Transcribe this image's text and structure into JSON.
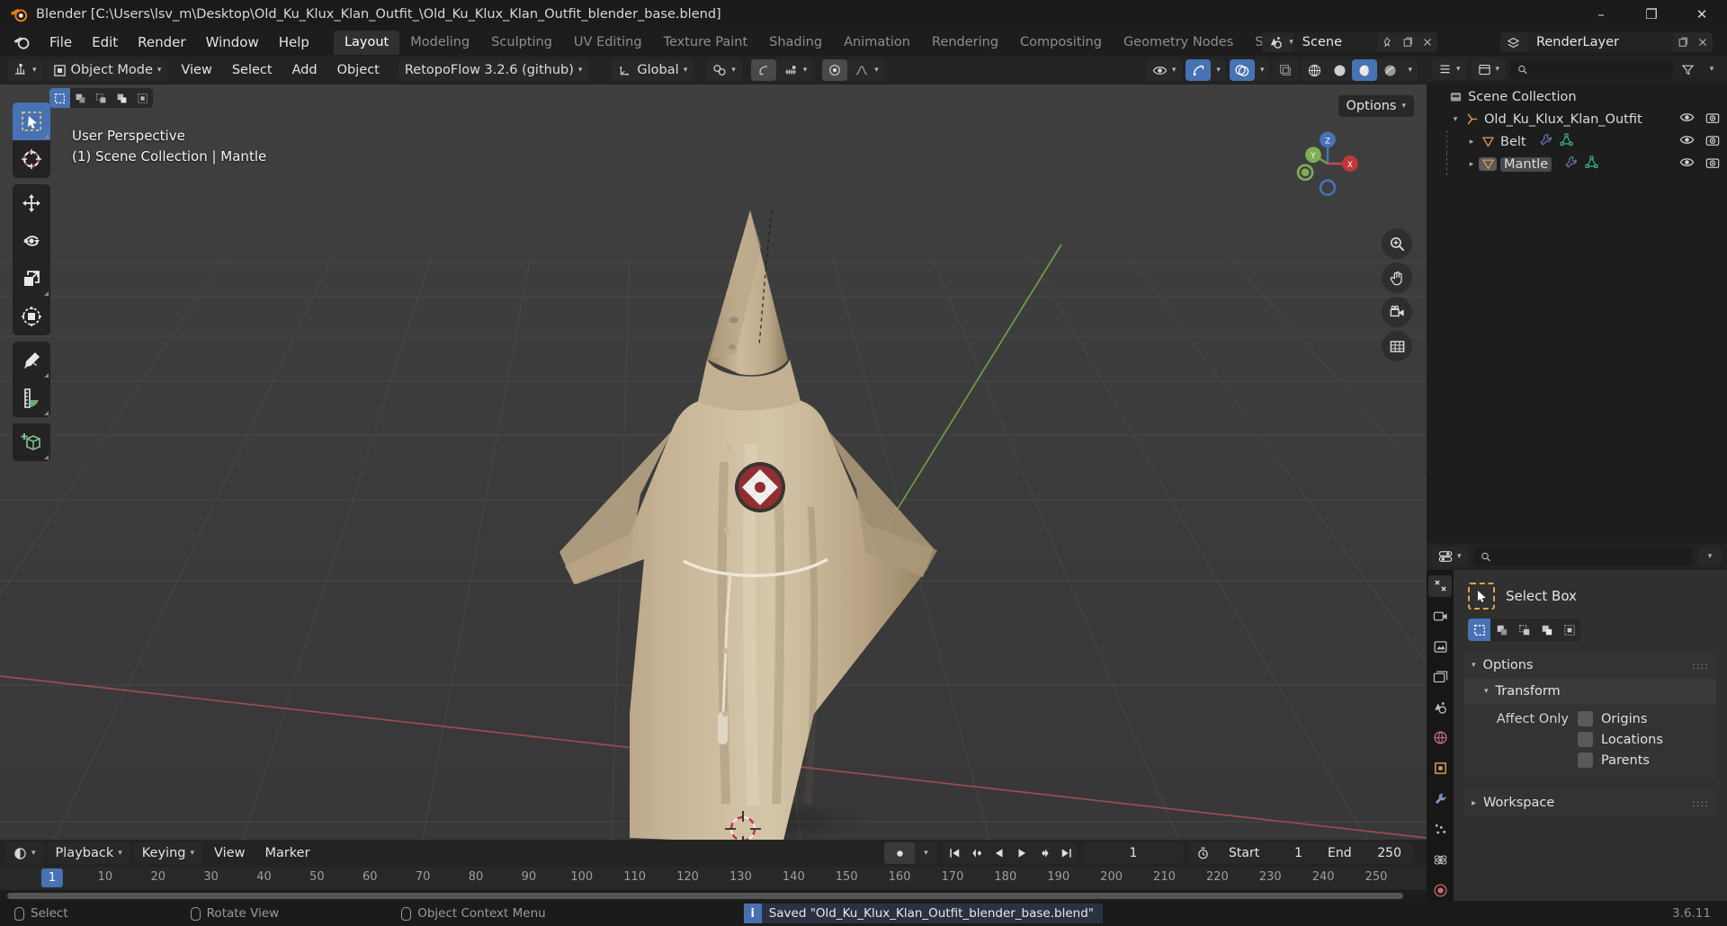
{
  "window": {
    "title": "Blender [C:\\Users\\lsv_m\\Desktop\\Old_Ku_Klux_Klan_Outfit_\\Old_Ku_Klux_Klan_Outfit_blender_base.blend]",
    "minimize": "–",
    "maximize": "❐",
    "close": "✕"
  },
  "topbar": {
    "menus": [
      "File",
      "Edit",
      "Render",
      "Window",
      "Help"
    ],
    "workspaces": [
      {
        "label": "Layout",
        "active": true
      },
      {
        "label": "Modeling",
        "active": false
      },
      {
        "label": "Sculpting",
        "active": false
      },
      {
        "label": "UV Editing",
        "active": false
      },
      {
        "label": "Texture Paint",
        "active": false
      },
      {
        "label": "Shading",
        "active": false
      },
      {
        "label": "Animation",
        "active": false
      },
      {
        "label": "Rendering",
        "active": false
      },
      {
        "label": "Compositing",
        "active": false
      },
      {
        "label": "Geometry Nodes",
        "active": false
      },
      {
        "label": "Scripting",
        "active": false
      }
    ],
    "add_workspace": "+",
    "scene_name": "Scene",
    "view_layer_name": "RenderLayer"
  },
  "viewport_header": {
    "mode": "Object Mode",
    "menus": [
      "View",
      "Select",
      "Add",
      "Object"
    ],
    "addon_menu": "RetopoFlow 3.2.6 (github)",
    "transform_orientation": "Global",
    "options_label": "Options"
  },
  "viewport": {
    "perspective": "User Perspective",
    "collection_info": "(1) Scene Collection | Mantle",
    "gizmo_axes": {
      "x": "X",
      "y": "Y",
      "z": "Z"
    }
  },
  "toolbar": {
    "tools": [
      {
        "name": "tweak-tool",
        "selected": false
      },
      {
        "name": "select-box-tool",
        "selected": true
      },
      {
        "name": "cursor-tool",
        "selected": false
      },
      {
        "name": "move-tool",
        "selected": false
      },
      {
        "name": "rotate-tool",
        "selected": false
      },
      {
        "name": "scale-tool",
        "selected": false
      },
      {
        "name": "transform-tool",
        "selected": false
      },
      {
        "name": "annotate-tool",
        "selected": false
      },
      {
        "name": "measure-tool",
        "selected": false
      },
      {
        "name": "add-cube-tool",
        "selected": false
      }
    ]
  },
  "outliner": {
    "search_placeholder": "",
    "rows": [
      {
        "label": "Scene Collection",
        "indent": 0,
        "icon": "collection-icon",
        "arrow": "",
        "selected": false,
        "modifiers": false,
        "visibility": false
      },
      {
        "label": "Old_Ku_Klux_Klan_Outfit",
        "indent": 1,
        "icon": "armature-icon",
        "arrow": "▾",
        "selected": false,
        "modifiers": false,
        "visibility": true
      },
      {
        "label": "Belt",
        "indent": 2,
        "icon": "mesh-object-icon",
        "arrow": "▸",
        "selected": false,
        "modifiers": true,
        "visibility": true
      },
      {
        "label": "Mantle",
        "indent": 2,
        "icon": "mesh-object-icon",
        "arrow": "▸",
        "selected": true,
        "modifiers": true,
        "visibility": true
      }
    ]
  },
  "properties": {
    "search_placeholder": "",
    "tool_title": "Select Box",
    "select_modes": [
      "set-mode",
      "extend-mode",
      "subtract-mode",
      "invert-mode",
      "intersect-mode"
    ],
    "active_select_mode": 0,
    "panels": [
      {
        "title": "Options",
        "open": true
      },
      {
        "title": "Transform",
        "open": true,
        "sub": true
      },
      {
        "title": "Workspace",
        "open": false
      }
    ],
    "affect_only_label": "Affect Only",
    "affect_only_options": [
      {
        "label": "Origins",
        "checked": false
      },
      {
        "label": "Locations",
        "checked": false
      },
      {
        "label": "Parents",
        "checked": false
      }
    ]
  },
  "timeline": {
    "menus": [
      "Playback",
      "Keying",
      "View",
      "Marker"
    ],
    "current_frame": "1",
    "start_label": "Start",
    "start_value": "1",
    "end_label": "End",
    "end_value": "250",
    "ticks": [
      "1",
      "10",
      "20",
      "30",
      "40",
      "50",
      "60",
      "70",
      "80",
      "90",
      "100",
      "110",
      "120",
      "130",
      "140",
      "150",
      "160",
      "170",
      "180",
      "190",
      "200",
      "210",
      "220",
      "230",
      "240",
      "250"
    ],
    "playhead_frame": "1"
  },
  "status": {
    "items": [
      {
        "label": "Select",
        "icon": "mouse-left-icon"
      },
      {
        "label": "Rotate View",
        "icon": "mouse-middle-icon"
      },
      {
        "label": "Object Context Menu",
        "icon": "mouse-right-icon"
      }
    ],
    "message": "Saved \"Old_Ku_Klux_Klan_Outfit_blender_base.blend\"",
    "version": "3.6.11"
  },
  "colors": {
    "accent_blue": "#4772b3",
    "orange": "#e0a050",
    "panel_bg": "#303030",
    "editor_bg": "#1d1d1d",
    "header_bg": "#232323",
    "viewport_bg": "#3d3d3d"
  }
}
